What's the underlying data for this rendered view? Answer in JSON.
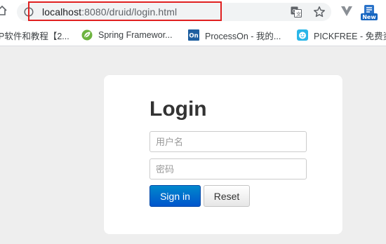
{
  "browser": {
    "url_host": "localhost",
    "url_rest": ":8080/druid/login.html",
    "icons": [
      "home-icon",
      "info-icon",
      "translate-icon",
      "star-icon",
      "vpn-icon",
      "new-extension-icon"
    ],
    "extension_badge": "New",
    "highlight_color": "#e02020"
  },
  "bookmarks": [
    {
      "label": "P软件和教程【2...",
      "icon": "bookmark-page-icon"
    },
    {
      "label": "Spring Framewor...",
      "icon": "spring-leaf-icon"
    },
    {
      "label": "ProcessOn - 我的...",
      "icon": "processon-icon",
      "icon_text": "On"
    },
    {
      "label": "PICKFREE - 免费资",
      "icon": "pickfree-icon"
    }
  ],
  "login": {
    "title": "Login",
    "username_placeholder": "用户名",
    "password_placeholder": "密码",
    "signin_label": "Sign in",
    "reset_label": "Reset"
  },
  "colors": {
    "page_background": "#eeeeee",
    "primary_button": "#0066cc",
    "card_background": "#ffffff"
  }
}
